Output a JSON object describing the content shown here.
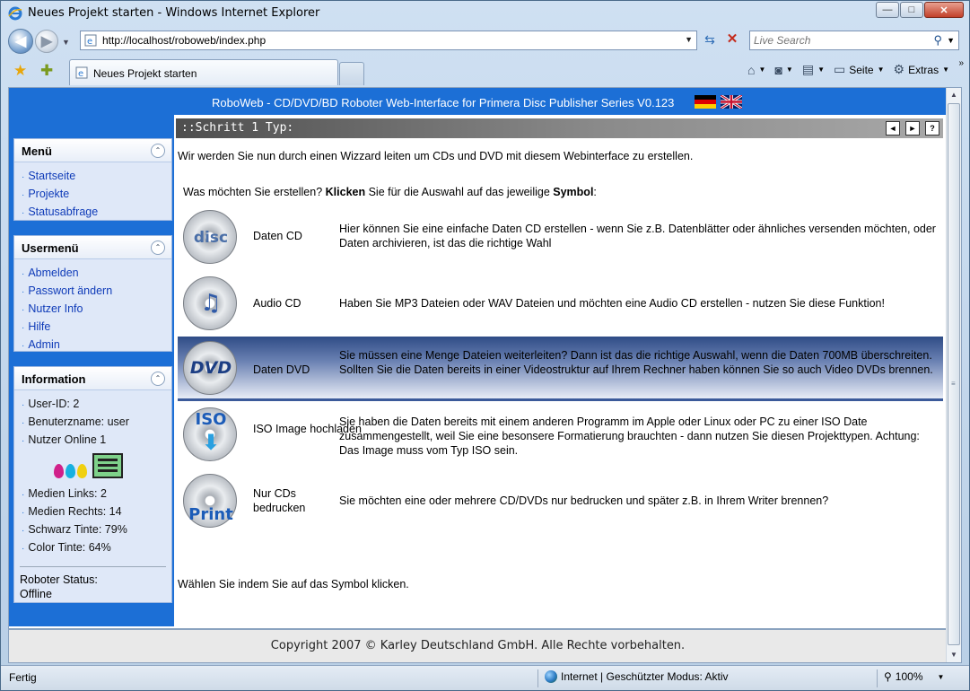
{
  "window": {
    "title": "Neues Projekt starten - Windows Internet Explorer",
    "minimize": "—",
    "maximize": "□",
    "close": "✕"
  },
  "browser": {
    "url": "http://localhost/roboweb/index.php",
    "search_placeholder": "Live Search",
    "tab_label": "Neues Projekt starten",
    "commands": {
      "page": "Seite",
      "extras": "Extras"
    }
  },
  "icons": {
    "back": "arrow-left-icon",
    "forward": "arrow-right-icon",
    "refresh": "refresh-icon",
    "stop": "stop-icon",
    "search": "magnifier-icon",
    "favorites": "star-icon",
    "add_favorites": "add-star-icon",
    "home": "home-icon",
    "feeds": "rss-icon",
    "print": "printer-icon",
    "page": "page-icon",
    "tools": "gear-icon"
  },
  "header": {
    "title": "RoboWeb - CD/DVD/BD Roboter Web-Interface for Primera Disc Publisher Series V0.123"
  },
  "menu": {
    "title": "Menü",
    "items": [
      "Startseite",
      "Projekte",
      "Statusabfrage"
    ]
  },
  "usermenu": {
    "title": "Usermenü",
    "items": [
      "Abmelden",
      "Passwort ändern",
      "Nutzer Info",
      "Hilfe",
      "Admin"
    ]
  },
  "info": {
    "title": "Information",
    "user_lines": [
      "User-ID: 2",
      "Benuterzname: user",
      "Nutzer Online 1"
    ],
    "media_lines": [
      "Medien Links: 2",
      "Medien Rechts: 14",
      "Schwarz Tinte: 79%",
      "Color Tinte: 64%"
    ],
    "robot_status_label": "Roboter Status:",
    "robot_status_value": "Offline"
  },
  "main": {
    "step_title": "::Schritt 1 Typ:",
    "step_buttons": [
      "◄",
      "►",
      "?"
    ],
    "intro": "Wir werden Sie nun durch einen Wizzard leiten um CDs und DVD mit diesem Webinterface zu erstellen.",
    "question_pre": "Was möchten Sie erstellen? ",
    "question_b1": "Klicken",
    "question_mid": " Sie für die Auswahl auf das jeweilige ",
    "question_b2": "Symbol",
    "question_post": ":",
    "options": [
      {
        "icon_text": "disc",
        "name": "Daten CD",
        "desc": "Hier können Sie eine einfache Daten CD erstellen - wenn Sie z.B. Datenblätter oder ähnliches versenden möchten, oder Daten archivieren, ist das die richtige Wahl"
      },
      {
        "icon_text": "♫",
        "name": "Audio CD",
        "desc": "Haben Sie MP3 Dateien oder WAV Dateien und möchten eine Audio CD erstellen - nutzen Sie diese Funktion!"
      },
      {
        "icon_text": "DVD",
        "name": "Daten DVD",
        "desc": "Sie müssen eine Menge Dateien weiterleiten? Dann ist das die richtige Auswahl, wenn die Daten 700MB überschreiten. Sollten Sie die Daten bereits in einer Videostruktur auf Ihrem Rechner haben können Sie so auch Video DVDs brennen."
      },
      {
        "icon_text": "ISO",
        "name": "ISO Image hochladen",
        "desc": "Sie haben die Daten bereits mit einem anderen Programm im Apple oder Linux oder PC zu einer ISO Date zusammengestellt, weil Sie eine besonsere Formatierung brauchten - dann nutzen Sie diesen Projekttypen. Achtung: Das Image muss vom Typ ISO sein."
      },
      {
        "icon_text": "Print",
        "name": "Nur CDs bedrucken",
        "desc": "Sie möchten eine oder mehrere CD/DVDs nur bedrucken und später z.B. in Ihrem Writer brennen?"
      }
    ],
    "footer_hint": "Wählen Sie indem Sie auf das Symbol klicken."
  },
  "copyright": "Copyright 2007 © Karley Deutschland GmbH. Alle Rechte vorbehalten.",
  "statusbar": {
    "left": "Fertig",
    "zone": "Internet | Geschützter Modus: Aktiv",
    "zoom": "100%"
  },
  "colors": {
    "header_blue": "#1c6fd6",
    "selected_row": "#3b5a9a",
    "link": "#0f3bb8"
  }
}
